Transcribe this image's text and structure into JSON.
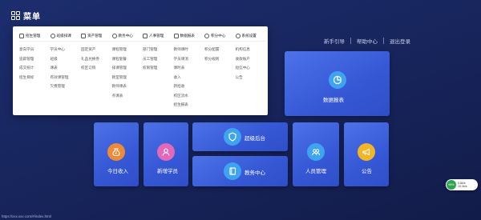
{
  "menu": {
    "label": "菜单"
  },
  "top_links": [
    "新手引导",
    "帮助中心",
    "退出登录"
  ],
  "dropdown": {
    "columns": [
      {
        "title": "招生管理",
        "icon": "calendar-icon",
        "items": [
          "意向学员",
          "追踪管理",
          "成交统计",
          "招生目标"
        ]
      },
      {
        "title": "班级排课",
        "icon": "clock-icon",
        "items": [
          "学员中心",
          "班级",
          "课表",
          "有效课管理",
          "欠费管理"
        ]
      },
      {
        "title": "资产管理",
        "icon": "money-icon",
        "items": [
          "固定资产",
          "礼品兑换券",
          "校区订购"
        ]
      },
      {
        "title": "教务中心",
        "icon": "book-icon",
        "items": [
          "课程管理",
          "课程套餐",
          "排课管理",
          "教室管理",
          "教师课表",
          "点课表"
        ]
      },
      {
        "title": "人事管理",
        "icon": "person-icon",
        "items": [
          "部门管理",
          "员工管理",
          "权限管理"
        ]
      },
      {
        "title": "数据报表",
        "icon": "chart-icon",
        "items": [
          "教师课时",
          "学员课消",
          "课时表",
          "收入",
          "新招收",
          "校区流水",
          "招生报表"
        ]
      },
      {
        "title": "积分中心",
        "icon": "star-icon",
        "items": [
          "积分配置",
          "积分规则"
        ]
      },
      {
        "title": "系统设置",
        "icon": "settings-icon",
        "items": [
          "机构信息",
          "收款账户",
          "短信中心",
          "公告"
        ]
      }
    ]
  },
  "tiles": {
    "data_report": "数据报表",
    "super_backend": "超级后台",
    "edu_center": "教务中心",
    "today_income": "今日收入",
    "new_student": "新增学员",
    "personnel": "人员管理",
    "announcement": "公告"
  },
  "help_widget": {
    "badge": "99%",
    "line1": "0.6k/s",
    "line2": "10.3k/s"
  },
  "status_url": "https://xxx.xxx.com/#/index.html",
  "colors": {
    "tile": "#3a5ed9",
    "background": "#1a2a66",
    "orange": "#f08a38",
    "pink": "#e268b8",
    "blue_icon": "#3ea4ef",
    "yellow": "#f2b526"
  }
}
